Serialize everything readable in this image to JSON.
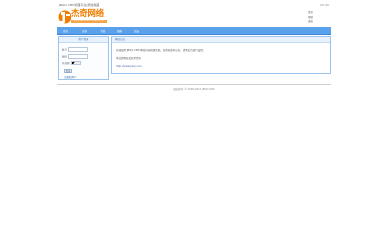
{
  "top": {
    "left_text": "JBQQ CMS管理平台|添加收藏",
    "right_buttons": [
      "button-a",
      "button-b"
    ]
  },
  "logo": {
    "name_cn": "杰奇网络",
    "name_en": "JIEQI NETWORK TECHNOLOGY",
    "accent": "#f07e00"
  },
  "header_links": [
    "首页",
    "帮助",
    "退出"
  ],
  "nav": {
    "bg_color": "#5aa1ec",
    "items": [
      "首页",
      "文章",
      "下载",
      "相册",
      "论坛"
    ]
  },
  "sidebar": {
    "title": "用户登录",
    "username_label": "账号",
    "password_label": "密码",
    "verify_label": "有效期",
    "verify_option": "不保存",
    "login_button": "登录",
    "register_link": "注册新用户"
  },
  "main": {
    "title": "网站公告",
    "line1": "欢迎使用 JBQQ CMS 网站内容管理系统，如需修改本公告，请到后台进行设置。",
    "line2": "本站提供各类技术资讯",
    "link": "http://www.jieqi.com"
  },
  "footer": {
    "text": "版权所有 © 2006-2012 JIEQI.COM"
  }
}
